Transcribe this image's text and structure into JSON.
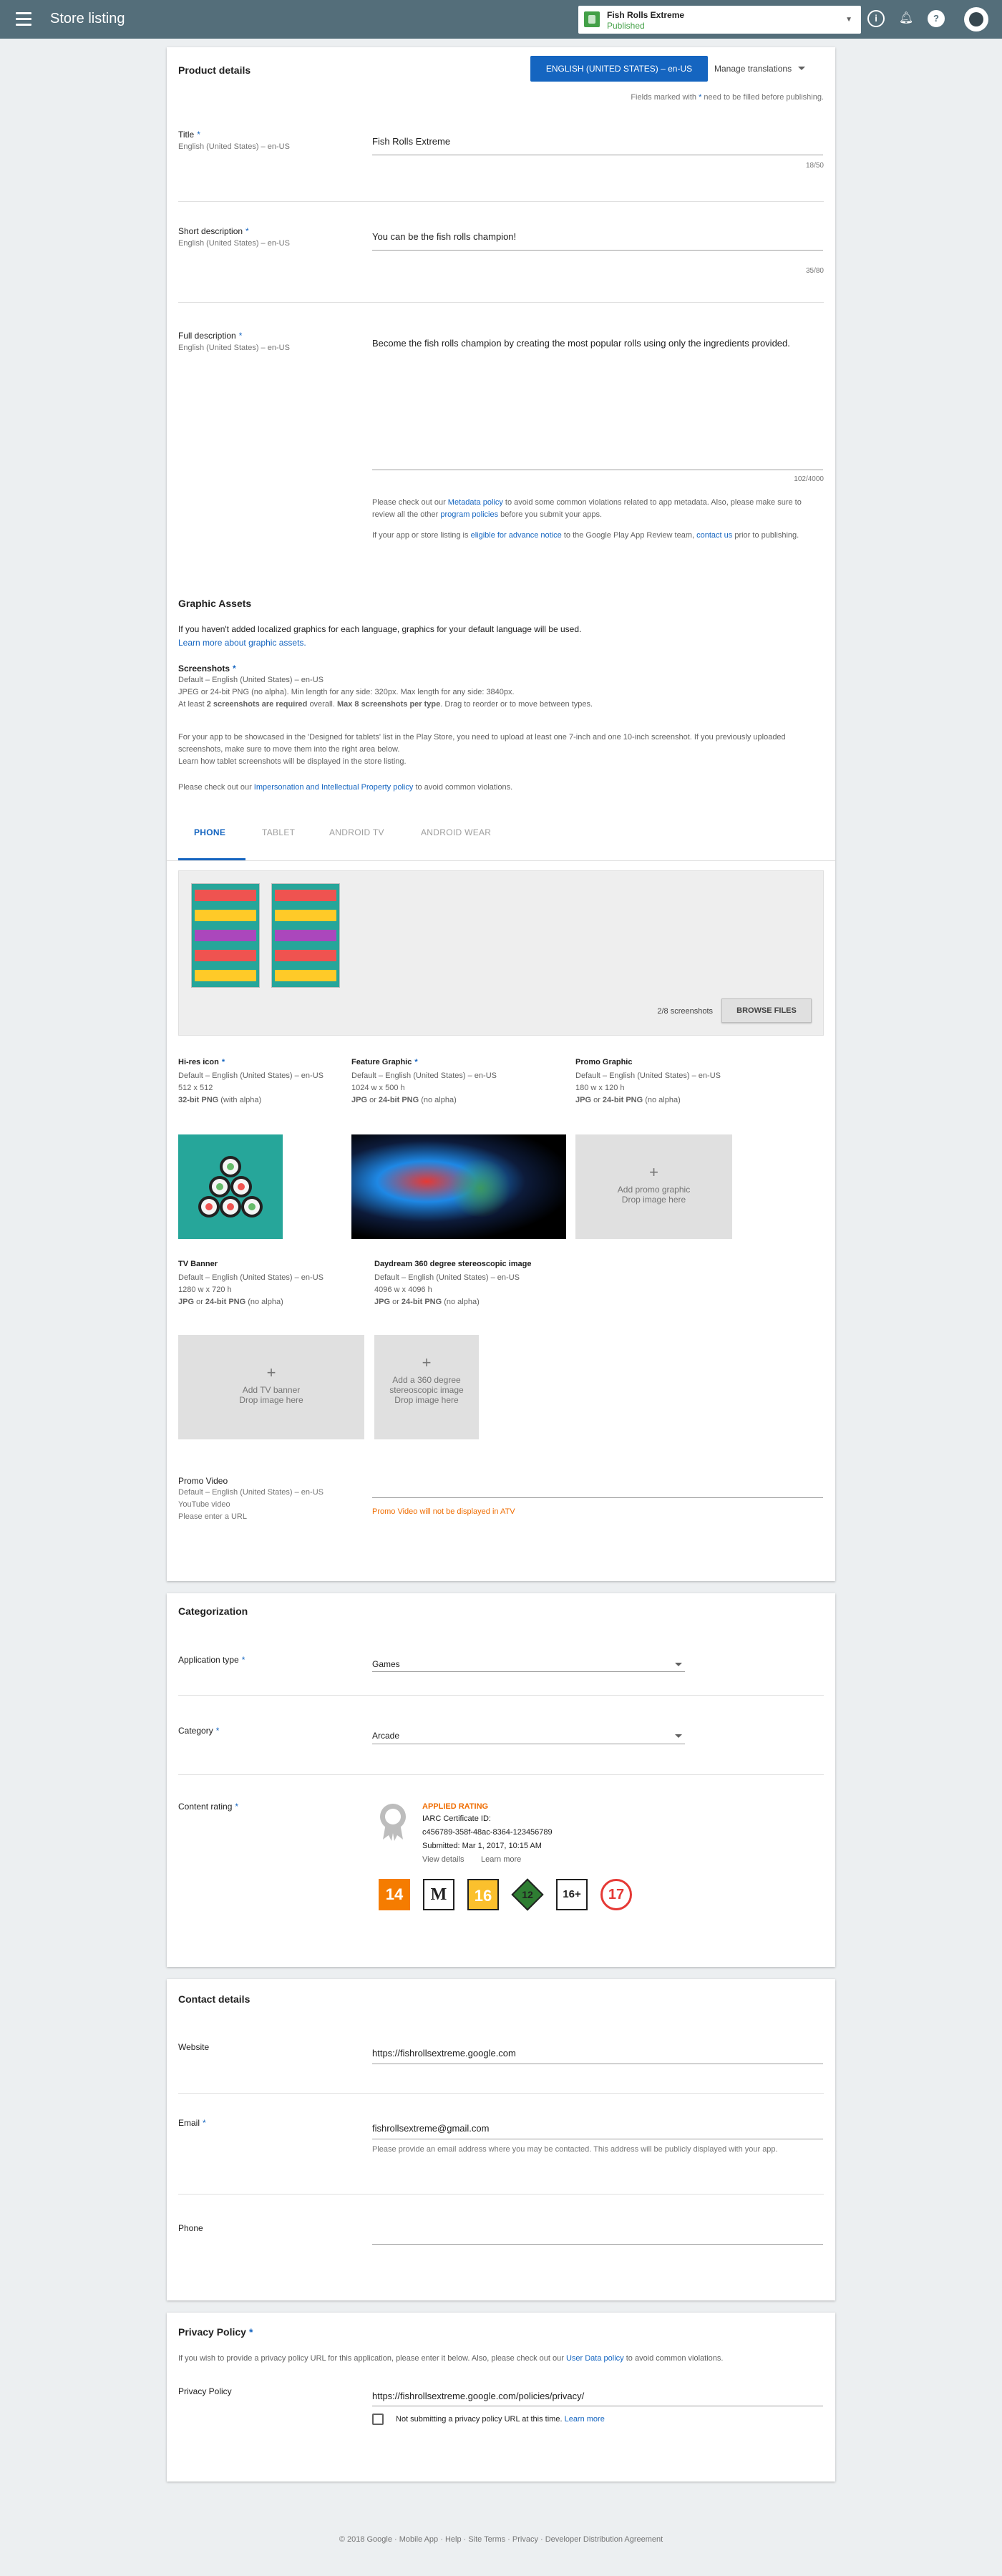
{
  "header": {
    "title": "Store listing",
    "app_name": "Fish Rolls Extreme",
    "app_status": "Published",
    "help_icon": "?",
    "info_icon": "i"
  },
  "product": {
    "section_title": "Product details",
    "language_button": "ENGLISH (UNITED STATES) – en-US",
    "manage_translations": "Manage translations",
    "required_note_pre": "Fields marked with",
    "required_note_post": "need to be filled before publishing.",
    "title_label": "Title",
    "lang_sub": "English (United States) – en-US",
    "title_value": "Fish Rolls Extreme",
    "title_counter": "18/50",
    "short_label": "Short description",
    "short_value": "You can be the fish rolls champion!",
    "short_counter": "35/80",
    "full_label": "Full description",
    "full_value": "Become the fish rolls champion by creating the most popular rolls using only the ingredients provided.",
    "full_counter": "102/4000",
    "policy_1_pre": "Please check out our",
    "policy_1_link": "Metadata policy",
    "policy_1_mid": "to avoid some common violations related to app metadata. Also, please make sure to review all the other",
    "policy_1_link2": "program policies",
    "policy_1_post": "before you submit your apps.",
    "policy_2_pre": "If your app or store listing is",
    "policy_2_link": "eligible for advance notice",
    "policy_2_mid": "to the Google Play App Review team,",
    "policy_2_link2": "contact us",
    "policy_2_post": "prior to publishing."
  },
  "graphics": {
    "title": "Graphic Assets",
    "intro": "If you haven't added localized graphics for each language, graphics for your default language will be used.",
    "learn_link": "Learn more about graphic assets.",
    "screens_label": "Screenshots",
    "screens_default": "Default – English (United States) – en-US",
    "screens_spec": "JPEG or 24-bit PNG (no alpha). Min length for any side: 320px. Max length for any side: 3840px.",
    "screens_req_pre": "At least",
    "screens_req_b1": "2 screenshots are required",
    "screens_req_mid": "overall.",
    "screens_req_b2": "Max 8 screenshots per type",
    "screens_req_post": ". Drag to reorder or to move between types.",
    "tablet_note": "For your app to be showcased in the 'Designed for tablets' list in the Play Store, you need to upload at least one 7-inch and one 10-inch screenshot. If you previously uploaded screenshots, make sure to move them into the right area below.",
    "tablet_link": "Learn how tablet screenshots will be displayed in the store listing.",
    "ip_pre": "Please check out our",
    "ip_link": "Impersonation and Intellectual Property policy",
    "ip_post": "to avoid common violations.",
    "tabs": [
      "PHONE",
      "TABLET",
      "ANDROID TV",
      "ANDROID WEAR"
    ],
    "screenshot_count": "2/8 screenshots",
    "browse_files": "BROWSE FILES",
    "hires_label": "Hi-res icon",
    "hires_default": "Default – English (United States) – en-US",
    "hires_size": "512 x 512",
    "hires_fmt_b": "32-bit PNG",
    "hires_fmt": "(with alpha)",
    "feature_label": "Feature Graphic",
    "feature_default": "Default – English (United States) – en-US",
    "feature_size": "1024 w x 500 h",
    "fmt_jpg": "JPG",
    "fmt_or": "or",
    "fmt_png": "24-bit PNG",
    "fmt_noalpha": "(no alpha)",
    "promo_label": "Promo Graphic",
    "promo_default": "Default – English (United States) – en-US",
    "promo_size": "180 w x 120 h",
    "promo_add": "Add promo graphic",
    "promo_drop": "Drop image here",
    "tv_label": "TV Banner",
    "tv_default": "Default – English (United States) – en-US",
    "tv_size": "1280 w x 720 h",
    "tv_add": "Add TV banner",
    "tv_drop": "Drop image here",
    "daydream_label": "Daydream 360 degree stereoscopic image",
    "daydream_default": "Default – English (United States) – en-US",
    "daydream_size": "4096 w x 4096 h",
    "daydream_add": "Add a 360 degree stereoscopic image",
    "daydream_drop": "Drop image here",
    "video_label": "Promo Video",
    "video_default": "Default – English (United States) – en-US",
    "video_type": "YouTube video",
    "video_hint": "Please enter a URL",
    "video_warning": "Promo Video will not be displayed in ATV"
  },
  "categorization": {
    "title": "Categorization",
    "app_type_label": "Application type",
    "app_type_value": "Games",
    "category_label": "Category",
    "category_value": "Arcade",
    "rating_label": "Content rating",
    "applied": "APPLIED RATING",
    "iarc": "IARC Certificate ID:",
    "cert_id": "c456789-358f-48ac-8364-123456789",
    "submitted": "Submitted: Mar 1, 2017, 10:15 AM",
    "view_details": "View details",
    "learn_more": "Learn more",
    "badges": [
      "14",
      "M",
      "16",
      "12",
      "16+",
      "17"
    ]
  },
  "contact": {
    "title": "Contact details",
    "website_label": "Website",
    "website_value": "https://fishrollsextreme.google.com",
    "email_label": "Email",
    "email_value": "fishrollsextreme@gmail.com",
    "email_note": "Please provide an email address where you may be contacted. This address will be publicly displayed with your app.",
    "phone_label": "Phone"
  },
  "privacy": {
    "title": "Privacy Policy",
    "intro_pre": "If you wish to provide a privacy policy URL for this application, please enter it below. Also, please check out our",
    "intro_link": "User Data policy",
    "intro_post": "to avoid common violations.",
    "label": "Privacy Policy",
    "value": "https://fishrollsextreme.google.com/policies/privacy/",
    "checkbox_label": "Not submitting a privacy policy URL at this time.",
    "learn_more": "Learn more"
  },
  "footer": {
    "text": "© 2018 Google · Mobile App · Help · Site Terms · Privacy · Developer Distribution Agreement"
  },
  "colors": {
    "topbar": "#546e7a",
    "accent": "#1565c0",
    "warning": "#ef6c00"
  }
}
